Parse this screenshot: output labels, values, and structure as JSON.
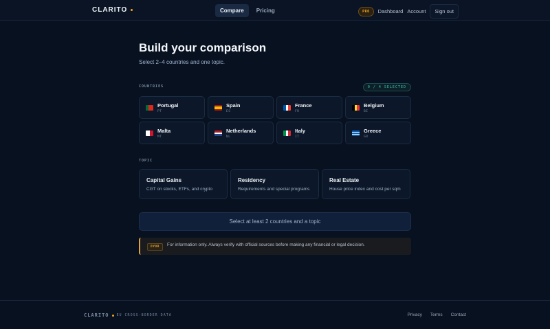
{
  "header": {
    "logo": "CLARITO",
    "nav": [
      {
        "label": "Compare",
        "active": true
      },
      {
        "label": "Pricing",
        "active": false
      }
    ],
    "pro_badge": "PRO",
    "dashboard": "Dashboard",
    "account": "Account",
    "sign_out": "Sign out"
  },
  "main": {
    "title": "Build your comparison",
    "subtitle": "Select 2–4 countries and one topic.",
    "countries_label": "COUNTRIES",
    "selected_count": "0 / 4 SELECTED",
    "countries": [
      {
        "name": "Portugal",
        "code": "PT",
        "flag_colors": [
          "#046a38",
          "#da291c",
          "#da291c"
        ],
        "flag_dir": "v"
      },
      {
        "name": "Spain",
        "code": "ES",
        "flag_colors": [
          "#aa151b",
          "#f1bf00",
          "#f1bf00",
          "#aa151b"
        ],
        "flag_dir": "h"
      },
      {
        "name": "France",
        "code": "FR",
        "flag_colors": [
          "#0055a4",
          "#ffffff",
          "#ef4135"
        ],
        "flag_dir": "v"
      },
      {
        "name": "Belgium",
        "code": "BE",
        "flag_colors": [
          "#000000",
          "#fdda24",
          "#ef3340"
        ],
        "flag_dir": "v"
      },
      {
        "name": "Malta",
        "code": "MT",
        "flag_colors": [
          "#ffffff",
          "#cf142b"
        ],
        "flag_dir": "v"
      },
      {
        "name": "Netherlands",
        "code": "NL",
        "flag_colors": [
          "#ae1c28",
          "#ffffff",
          "#21468b"
        ],
        "flag_dir": "h"
      },
      {
        "name": "Italy",
        "code": "IT",
        "flag_colors": [
          "#009246",
          "#ffffff",
          "#ce2b37"
        ],
        "flag_dir": "v"
      },
      {
        "name": "Greece",
        "code": "GR",
        "flag_colors": [
          "#0d5eaf",
          "#ffffff",
          "#0d5eaf",
          "#ffffff",
          "#0d5eaf"
        ],
        "flag_dir": "h"
      }
    ],
    "topic_label": "TOPIC",
    "topics": [
      {
        "title": "Capital Gains",
        "desc": "CGT on stocks, ETFs, and crypto"
      },
      {
        "title": "Residency",
        "desc": "Requirements and special programs"
      },
      {
        "title": "Real Estate",
        "desc": "House price index and cost per sqm"
      }
    ],
    "submit_label": "Select at least 2 countries and a topic",
    "notice_tag": "DYOR",
    "notice_text": "For information only. Always verify with official sources before making any financial or legal decision."
  },
  "footer": {
    "logo": "CLARITO",
    "tagline": "EU CROSS-BORDER DATA",
    "links": [
      "Privacy",
      "Terms",
      "Contact"
    ]
  },
  "colors": {
    "background": "#08111f",
    "accent": "#f5a623",
    "teal": "#3fc6b8"
  }
}
